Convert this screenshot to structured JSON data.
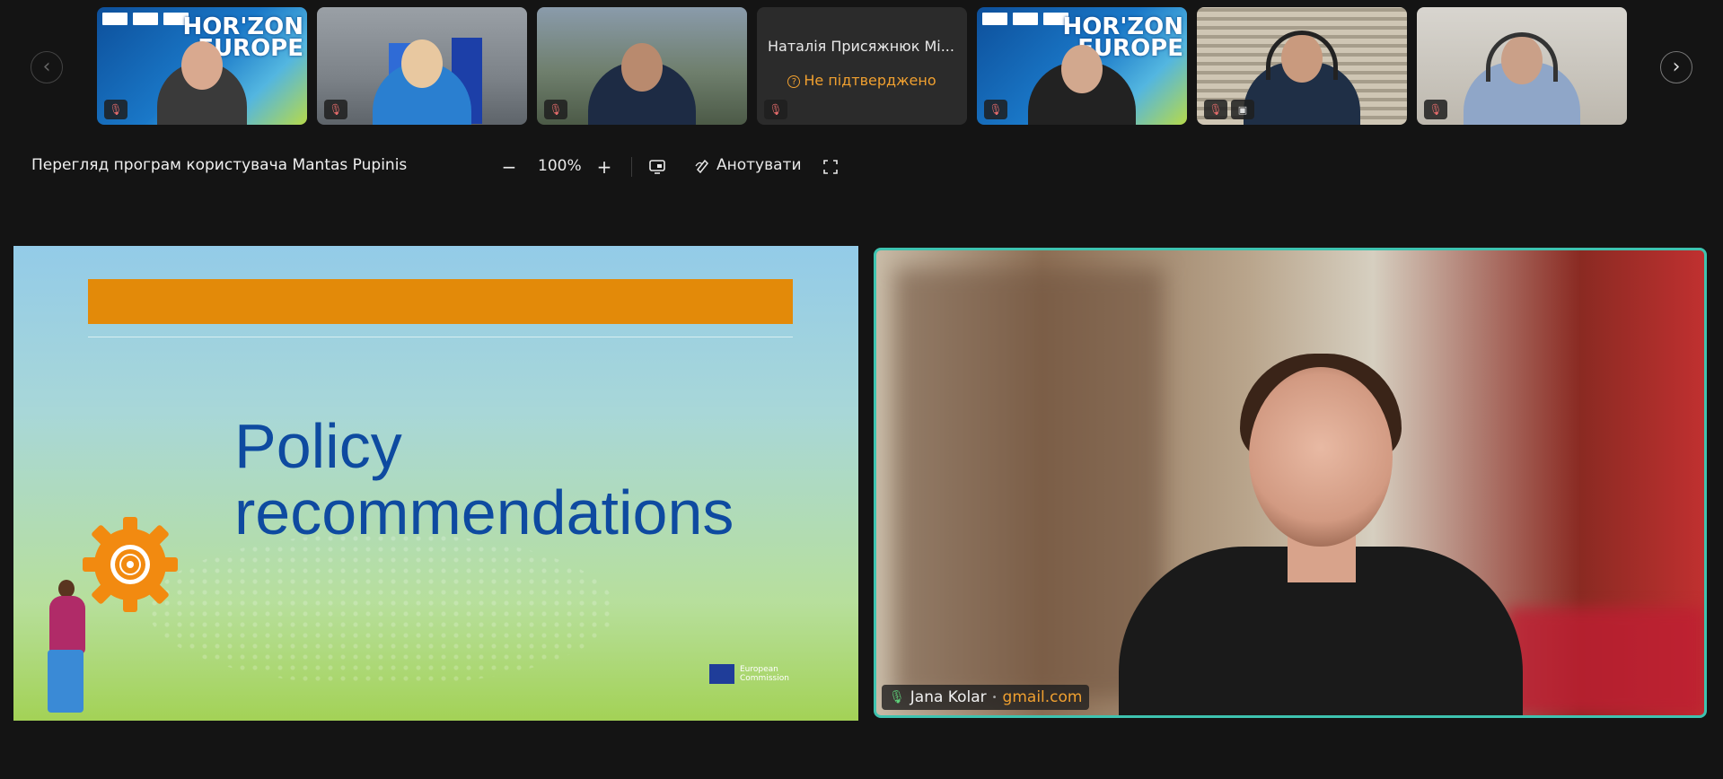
{
  "toolbar": {
    "view_title": "Перегляд програм користувача Mantas Pupinis",
    "zoom_out_icon": "−",
    "zoom_level": "100%",
    "zoom_in_icon": "+",
    "annotate_label": "Анотувати"
  },
  "participants": [
    {
      "background": "horizon-europe",
      "muted": true
    },
    {
      "background": "office-flags",
      "muted": true
    },
    {
      "background": "mountains",
      "muted": true
    },
    {
      "name": "Наталія Присяжнюк  Мі...",
      "status": "Не підтверджено",
      "muted": true
    },
    {
      "background": "horizon-europe",
      "muted": true
    },
    {
      "background": "window-blinds",
      "muted": true,
      "sharing": true
    },
    {
      "background": "room",
      "muted": true
    }
  ],
  "horizon_text": [
    "HOR'ZON",
    "EUROPE"
  ],
  "slide": {
    "title_line1": "Policy",
    "title_line2": "recommendations",
    "logo_line1": "European",
    "logo_line2": "Commission"
  },
  "speaker": {
    "name": "Jana Kolar",
    "separator": "•",
    "email": "gmail.com"
  },
  "colors": {
    "accent": "#3ec3b0",
    "slide_bar": "#e38a09",
    "slide_title": "#0e4aa0",
    "pending": "#f0a030"
  }
}
